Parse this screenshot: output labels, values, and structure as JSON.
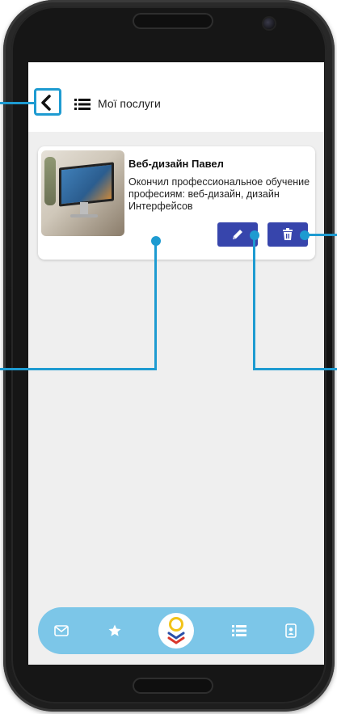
{
  "appbar": {
    "title": "Мої послуги",
    "back_icon": "chevron-left-icon",
    "menu_icon": "list-icon"
  },
  "service_card": {
    "title": "Веб-дизайн Павел",
    "description": "Окончил профессиональное обучение професиям: веб-дизайн, дизайн Интерфейсов",
    "edit_icon": "pencil-icon",
    "delete_icon": "trash-icon",
    "button_color": "#3745ac"
  },
  "bottom_nav": {
    "items": [
      {
        "icon": "mail-icon"
      },
      {
        "icon": "star-icon"
      },
      {
        "icon": "logo-icon"
      },
      {
        "icon": "list-icon"
      },
      {
        "icon": "contact-card-icon"
      }
    ],
    "background": "#7cc6e8"
  },
  "colors": {
    "accent": "#1e9bd1",
    "screen_bg": "#efefef"
  }
}
